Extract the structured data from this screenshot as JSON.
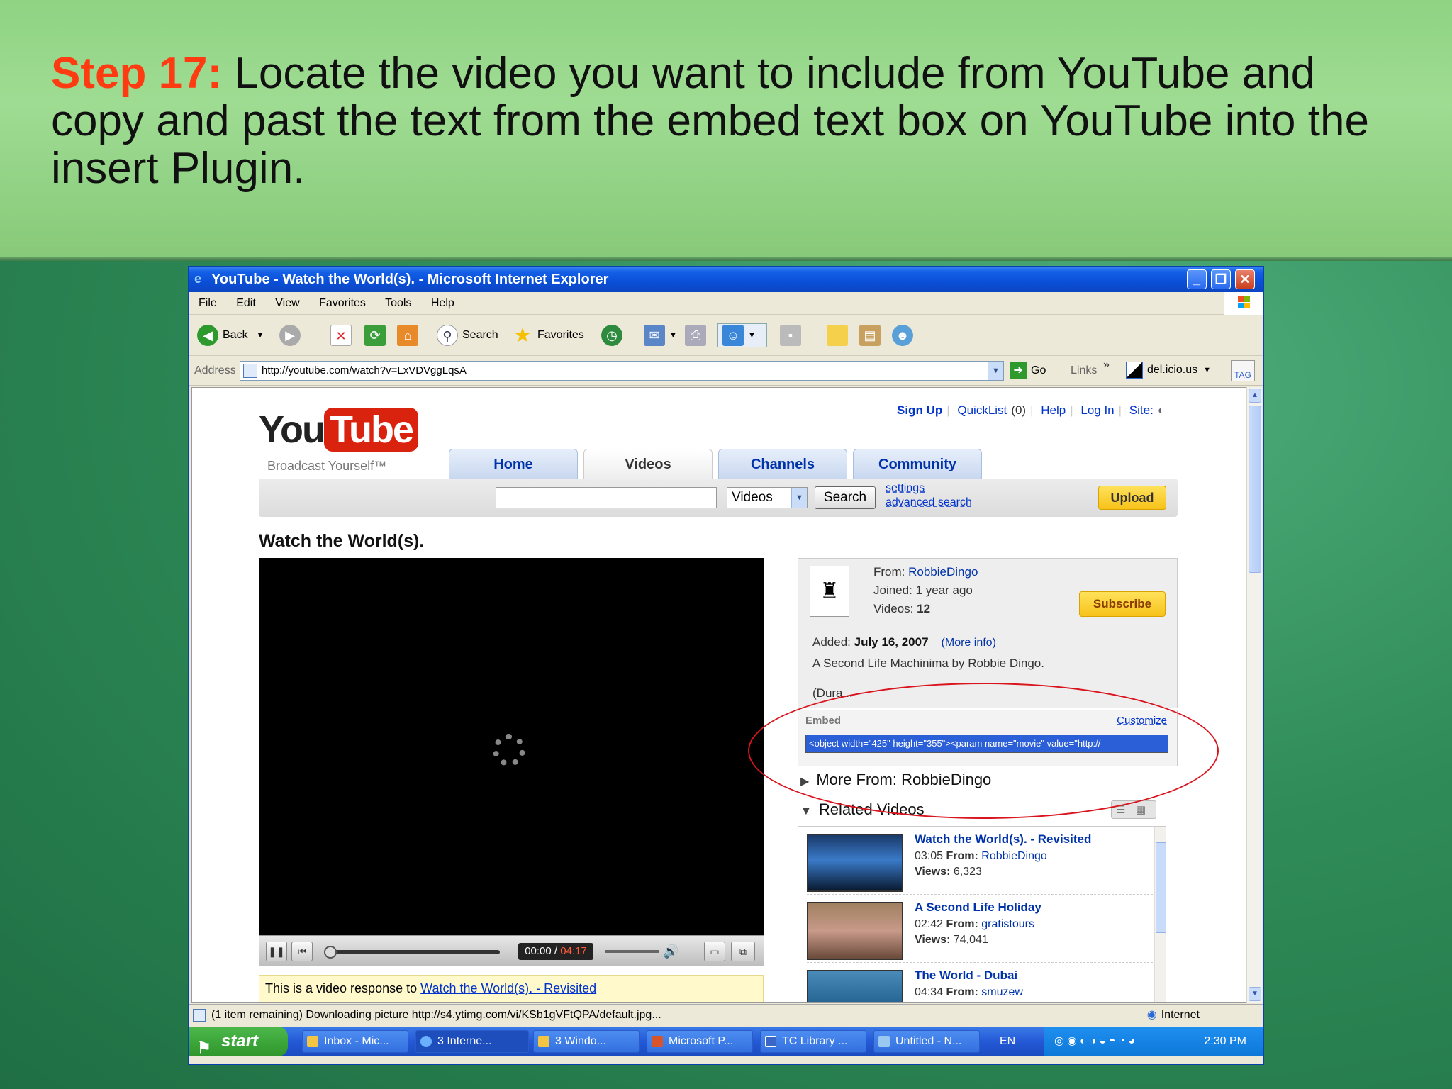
{
  "slide": {
    "title_highlight": "Step 17:",
    "title_text": " Locate the video you want to include from YouTube and copy and past the text from the embed text box on YouTube into the insert Plugin."
  },
  "window": {
    "title": "YouTube - Watch the World(s). - Microsoft Internet Explorer"
  },
  "menu": [
    "File",
    "Edit",
    "View",
    "Favorites",
    "Tools",
    "Help"
  ],
  "toolbar": {
    "back": "Back",
    "search": "Search",
    "favorites": "Favorites"
  },
  "address": {
    "label": "Address",
    "url": "http://youtube.com/watch?v=LxVDVggLqsA",
    "go": "Go",
    "links": "Links",
    "delicious": "del.icio.us",
    "tag": "TAG"
  },
  "yt": {
    "logo_you": "You",
    "logo_tube": "Tube",
    "tagline": "Broadcast Yourself™",
    "toplinks": {
      "signup": "Sign Up",
      "quicklist": "QuickList",
      "quicklist_count": "(0)",
      "help": "Help",
      "login": "Log In",
      "site": "Site:"
    },
    "tabs": [
      "Home",
      "Videos",
      "Channels",
      "Community"
    ],
    "search_select": "Videos",
    "search_button": "Search",
    "settings": "settings",
    "advanced": "advanced search",
    "upload": "Upload",
    "video_title": "Watch the World(s).",
    "time_current": "00:00",
    "time_total": "04:17",
    "response_text": "This is a video response to ",
    "response_link": "Watch the World(s). - Revisited",
    "from_label": "From:",
    "from_user": "RobbieDingo",
    "joined": "Joined: 1 year ago",
    "videos_label": "Videos:",
    "videos_count": "12",
    "subscribe": "Subscribe",
    "added_label": "Added:",
    "added_date": "July 16, 2007",
    "more_info": "(More info)",
    "description": "A Second Life Machinima by Robbie Dingo.",
    "duration": "(Dura...",
    "embed_label": "Embed",
    "customize": "Customize",
    "embed_code": "<object width=\"425\" height=\"355\"><param name=\"movie\" value=\"http://",
    "more_from": "More From: RobbieDingo",
    "related_head": "Related Videos",
    "related": [
      {
        "title": "Watch the World(s). - Revisited",
        "time": "03:05",
        "from": "RobbieDingo",
        "views": "6,323"
      },
      {
        "title": "A Second Life Holiday",
        "time": "02:42",
        "from": "gratistours",
        "views": "74,041"
      },
      {
        "title": "The World - Dubai",
        "time": "04:34",
        "from": "smuzew",
        "views": ""
      }
    ],
    "from_word": "From:",
    "views_word": "Views:"
  },
  "status": {
    "text": "(1 item remaining) Downloading picture http://s4.ytimg.com/vi/KSb1gVFtQPA/default.jpg...",
    "zone": "Internet"
  },
  "taskbar": {
    "start": "start",
    "tasks": [
      "Inbox - Mic...",
      "3 Interne...",
      "3 Windo...",
      "Microsoft P...",
      "TC Library ...",
      "Untitled - N..."
    ],
    "lang": "EN",
    "clock": "2:30 PM"
  }
}
